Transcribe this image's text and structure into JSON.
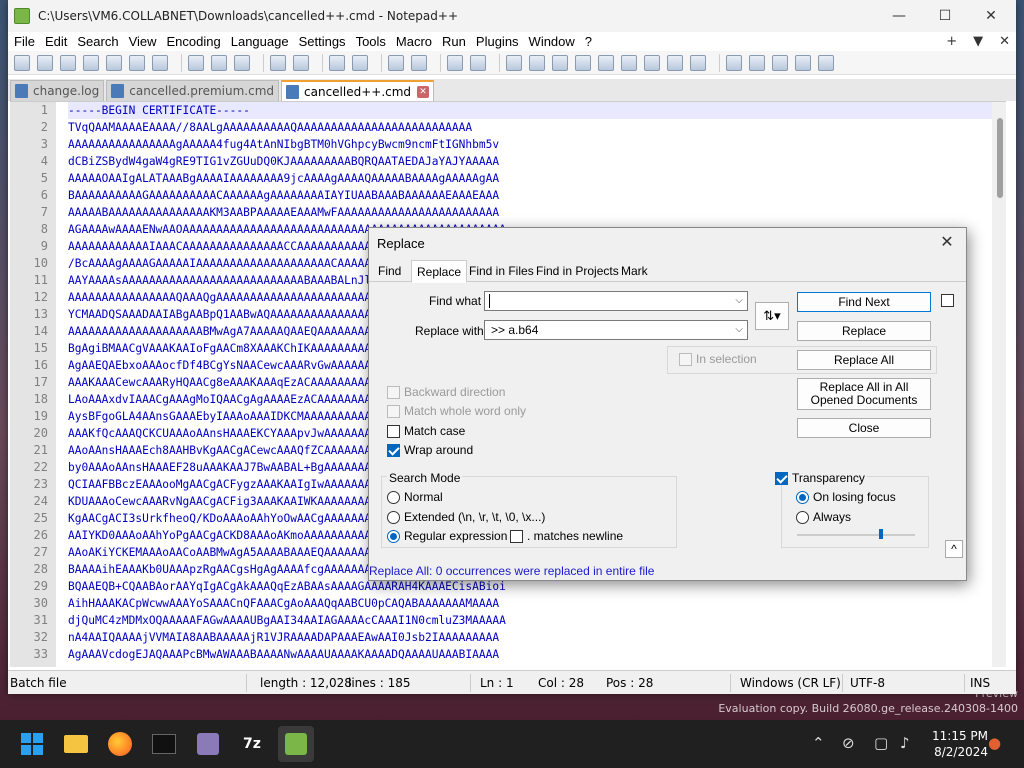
{
  "window": {
    "title": "C:\\Users\\VM6.COLLABNET\\Downloads\\cancelled++.cmd - Notepad++",
    "minimize": "—",
    "maximize": "☐",
    "close": "✕"
  },
  "menu": [
    "File",
    "Edit",
    "Search",
    "View",
    "Encoding",
    "Language",
    "Settings",
    "Tools",
    "Macro",
    "Run",
    "Plugins",
    "Window",
    "?"
  ],
  "menu_right": {
    "plus": "+",
    "down": "▼",
    "close": "✕"
  },
  "tabs": [
    {
      "label": "change.log",
      "active": false
    },
    {
      "label": "cancelled.premium.cmd",
      "active": false
    },
    {
      "label": "cancelled++.cmd",
      "active": true
    }
  ],
  "editor": {
    "line_numbers": [
      "1",
      "2",
      "3",
      "4",
      "5",
      "6",
      "7",
      "8",
      "9",
      "10",
      "11",
      "12",
      "13",
      "14",
      "15",
      "16",
      "17",
      "18",
      "19",
      "20",
      "21",
      "22",
      "23",
      "24",
      "25",
      "26",
      "27",
      "28",
      "29",
      "30",
      "31",
      "32",
      "33"
    ],
    "lines": [
      "-----BEGIN CERTIFICATE-----",
      "TVqQAAMAAAAEAAAA//8AALgAAAAAAAAAAQAAAAAAAAAAAAAAAAAAAAAAAAAA",
      "AAAAAAAAAAAAAAAAgAAAAA4fug4AtAnNIbgBTM0hVGhpcyBwcm9ncmFtIGNhbm5v",
      "dCBiZSBydW4gaW4gRE9TIG1vZGUuDQ0KJAAAAAAAAABQRQAATAEDAJaYAJYAAAAA",
      "AAAAAOAAIgALATAAABgAAAAIAAAAAAAA9jcAAAAgAAAAQAAAAABAAAAgAAAAAgAA",
      "BAAAAAAAAAAGAAAAAAAAAACAAAAAAgAAAAAAAAIAYIUAABAAABAAAAAAEAAAEAAA",
      "AAAAABAAAAAAAAAAAAAAAKM3AABPAAAAAEAAAMwFAAAAAAAAAAAAAAAAAAAAAAAA",
      "AGAAAAwAAAAENwAAOAAAAAAAAAAAAAAAAAAAAAAAAAAAAAAAAAAAAAAAAAAAAAAAA",
      "AAAAAAAAAAAAIAAACAAAAAAAAAAAAAAACCAAAAAAAAAAAAAAAAAAAAAAAAAAAAAA",
      "/BcAAAAgAAAAGAAAAAIAAAAAAAAAAAAAAAAAAAACAAAAAAAAAAAAAAAAAAAAAAAAA",
      "AAYAAAAsAAAAAAAAAAAAAAAAAAAAAAAAAAABAAABALnJlbG9jAAAAAAAAAAAAAAAA",
      "AAAAAAAAAAAAAAAAQAAAQgAAAAAAAAAAAAAAAAAAAAAAAAAAAAAAAAAAAAAAAAAA",
      "YCMAADQSAAADAAIABgAABpQ1AABwAQAAAAAAAAAAAAAAAAAAAAAAAAAAAAAAAAAA",
      "AAAAAAAAAAAAAAAAAAAABMwAgA7AAAAAQAAEQAAAAAAAAAAAAAAAAAAAAAAAAAAA",
      "BgAgiBMAACgVAAAKAAIoFgAACm8XAAAKChIKAAAAAAAAAAAAAAAAAAAAAAAAAAAA",
      "AgAAEQAEbxoAAAocfDf4BCgYsNAACewcAAARvGwAAAAAAAAAAAAAAAAAAAAAAAAA",
      "AAAKAAACewcAAARyHQAACg8eAAAKAAAqEzACAAAAAAAAAAAAAAAAAAAAAAAAAAAA",
      "LAoAAAxdvIAAACgAAAgMoIQAACgAgAAAAEzACAAAAAAAAAAAAAAAAAAAAAAAAAAA",
      "AysBFgoGLA4AAnsGAAAEbyIAAAoAAAIDKCMAAAAAAAAAAAAAAAAAAAAAAAAAAAAA",
      "AAAKfQcAAAQCKCUAAAoAAnsHAAAEKCYAAApvJwAAAAAAAAAAAAAAAAAAAAAAAAAA",
      "AAoAAnsHAAAEch8AAHBvKgAACgACewcAAAQfZCAAAAAAAAAAAAAAAAAAAAAAAAAA",
      "by0AAAoAAnsHAAAEF28uAAAKAAJ7BwAABAL+BgAAAAAAAAAAAAAAAAAAAAAAAAAA",
      "QCIAAFBBczEAAAooMgAACgACFygzAAAKAAIgIwAAAAAAAAAAAAAAAAAAAAAAAAAA",
      "KDUAAAoCewcAAARvNgAACgACFig3AAAKAAIWKAAAAAAAAAAAAAAAAAAAAAAAAAAA",
      "KgAACgACI3sUrkfheoQ/KDoAAAoAAhYoOwAACgAAAAAAAAAAAAAAAAAAAAAAAAAA",
      "AAIYKD0AAAoAAhYoPgAACgACKD8AAAoAKmoAAAAAAAAAAAAAAAAAAAAAAAAAAAAA",
      "AAoAKiYCKEMAAAoAACoAABMwAgA5AAAABAAAEQAAAAAAAAAAAAAAAAAAAAAAAAAA",
      "BAAAAihEAAAKb0UAAApzRgAACgsHgAgAAAAfcgAAAAAAAAAAAAAAAAAAAAAAAAAA",
      "BQAAEQB+CQAABAorAAYqIgACgAkAAAQqEzABAAsAAAAGAAAARAH4KAAAECisABioi",
      "AihHAAAKACpWcwwAAAYoSAAACnQFAAACgAoAAAQqAABCU0pCAQABAAAAAAAMAAAA",
      "djQuMC4zMDMxOQAAAAAFAGwAAAAUBgAAI34AAIAGAAAAcCAAAI1N0cmluZ3MAAAAA",
      "nA4AAIQAAAAjVVMAIA8AABAAAAAjR1VJRAAAADAPAAAEAwAAI0Jsb2IAAAAAAAAA",
      "AgAAAVcdogEJAQAAAPcBMwAWAAABAAAANwAAAAUAAAAKAAAADQAAAAUAAABIAAAA"
    ]
  },
  "status": {
    "type": "Batch file",
    "length": "length : 12,028",
    "lines": "lines : 185",
    "ln": "Ln : 1",
    "col": "Col : 28",
    "pos": "Pos : 28",
    "eol": "Windows (CR LF)",
    "encoding": "UTF-8",
    "mode": "INS"
  },
  "dialog": {
    "title": "Replace",
    "tabs": [
      "Find",
      "Replace",
      "Find in Files",
      "Find in Projects",
      "Mark"
    ],
    "find_label": "Find what :",
    "find_value": "",
    "replace_label": "Replace with :",
    "replace_value": ">> a.b64",
    "buttons": {
      "find_next": "Find Next",
      "replace": "Replace",
      "replace_all": "Replace All",
      "replace_all_opened": "Replace All in All Opened Documents",
      "close": "Close"
    },
    "in_selection": "In selection",
    "options": {
      "backward": "Backward direction",
      "whole_word": "Match whole word only",
      "match_case": "Match case",
      "wrap": "Wrap around"
    },
    "search_mode": {
      "title": "Search Mode",
      "normal": "Normal",
      "extended": "Extended (\\n, \\r, \\t, \\0, \\x...)",
      "regex": "Regular expression",
      "matches_newline": ". matches newline"
    },
    "transparency": {
      "title": "Transparency",
      "on_losing_focus": "On losing focus",
      "always": "Always"
    },
    "status_message": "Replace All: 0 occurrences were replaced in entire file"
  },
  "watermark": {
    "line1": "Preview",
    "line2": "Evaluation copy. Build 26080.ge_release.240308-1400"
  },
  "taskbar": {
    "time": "11:15 PM",
    "date": "8/2/2024"
  },
  "colors": {
    "code_text": "#0000c0",
    "accent": "#0067c0",
    "dialog_status": "#1a1acc"
  }
}
